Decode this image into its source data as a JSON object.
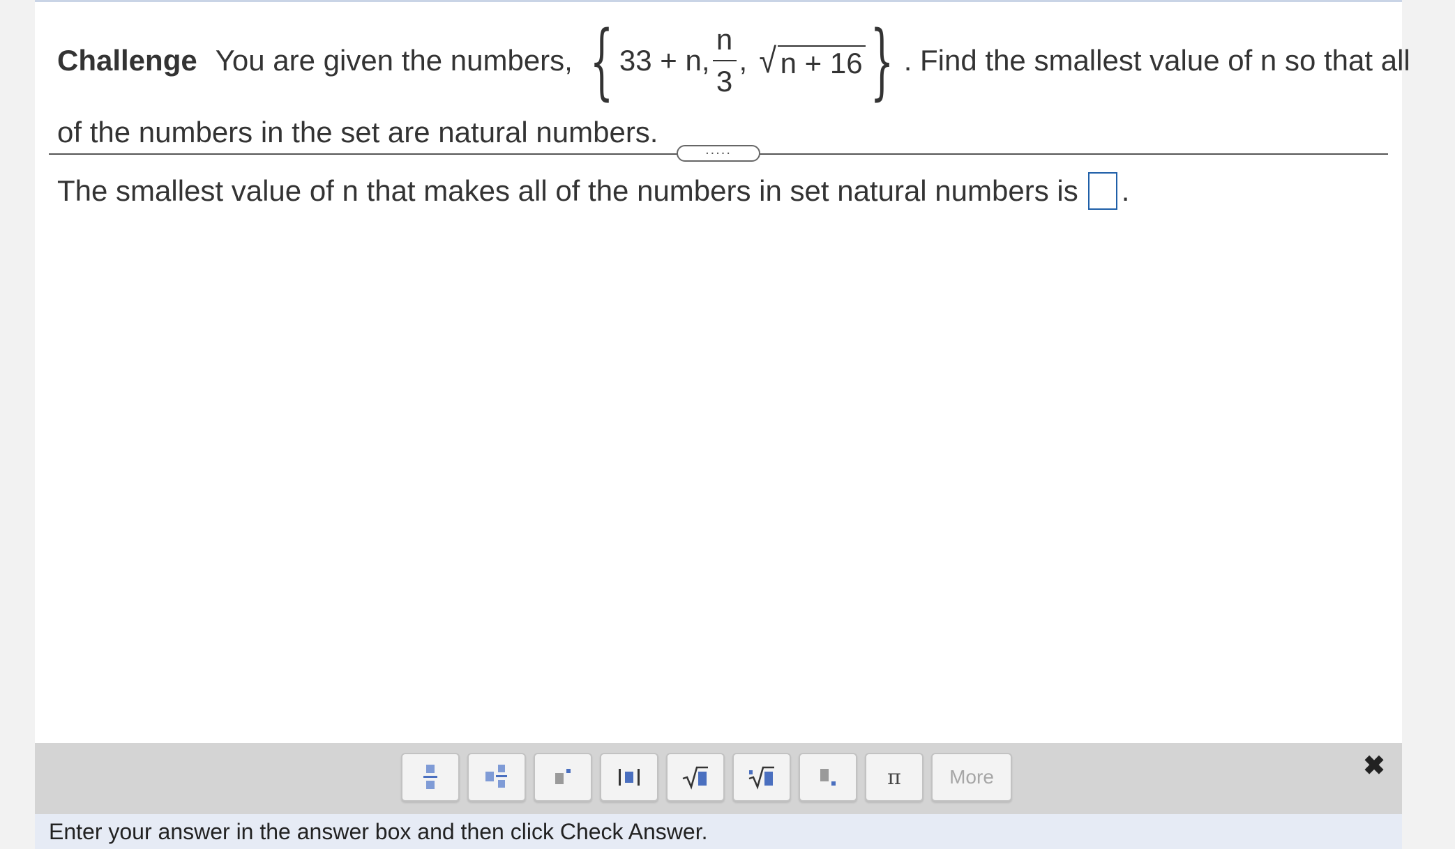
{
  "question": {
    "label": "Challenge",
    "intro": "You are given the numbers,",
    "set": {
      "item1": "33 + n,",
      "item2_num": "n",
      "item2_den": "3",
      "item2_sep": ",",
      "item3_radicand": "n + 16"
    },
    "after_set": ". Find the smallest value of n so that all",
    "line2": "of the numbers in the set are natural numbers."
  },
  "grip_label": ".....",
  "answer": {
    "prompt": "The smallest value of n that makes all of the numbers in set natural numbers is",
    "value": "",
    "suffix": "."
  },
  "toolbar": {
    "buttons": [
      "fraction-icon",
      "mixed-number-icon",
      "exponent-icon",
      "absolute-value-icon",
      "square-root-icon",
      "nth-root-icon",
      "subscript-icon",
      "pi-icon"
    ],
    "pi_symbol": "π",
    "more_label": "More",
    "close_symbol": "✖"
  },
  "status_text": "Enter your answer in the answer box and then click Check Answer."
}
